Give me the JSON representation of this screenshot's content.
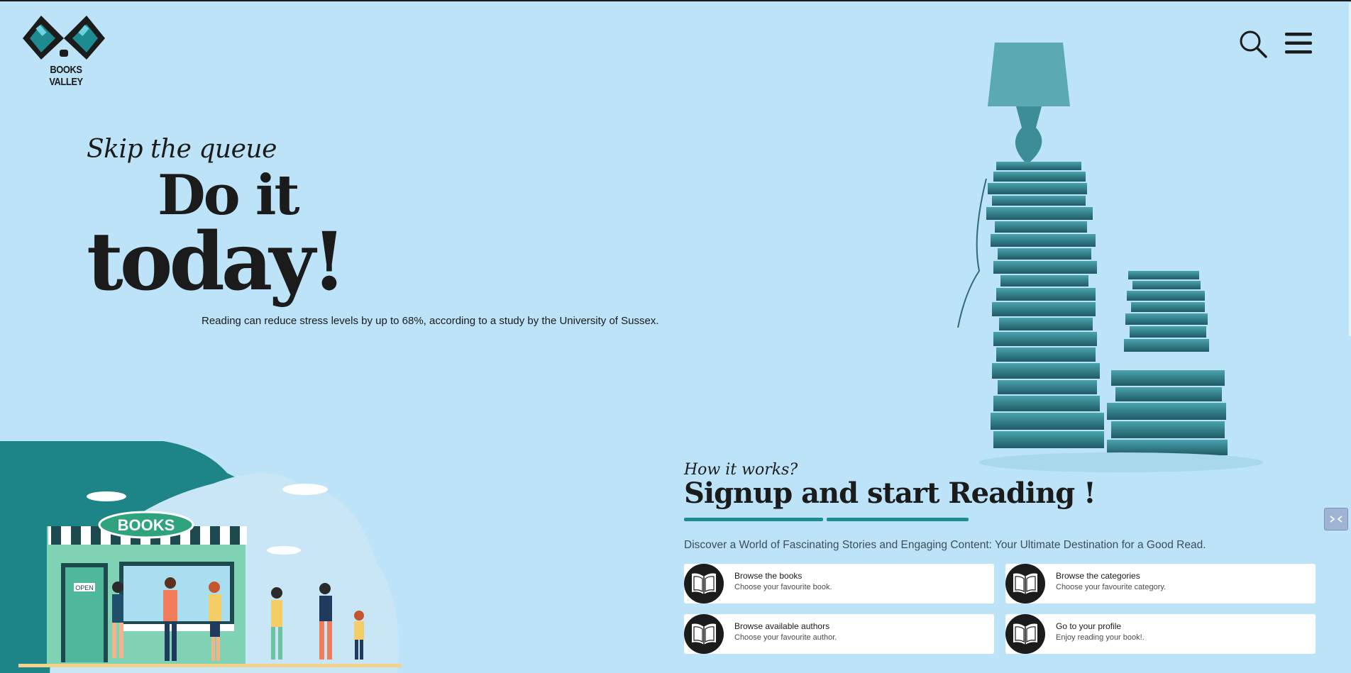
{
  "brand": {
    "name": "BOOKS VALLEY",
    "colors": {
      "primary": "#1b1b1b",
      "accent": "#1d8b8f",
      "background": "#bce3f7"
    }
  },
  "header": {
    "icons": [
      "search-icon",
      "hamburger-menu-icon"
    ]
  },
  "hero": {
    "tagline": "Skip the queue",
    "headline_line1": "Do it",
    "headline_line2": "today!",
    "fact": "Reading can reduce stress levels by up to 68%, according to a study by the University of Sussex."
  },
  "shop_illustration": {
    "sign": "BOOKS",
    "door_sign": "OPEN"
  },
  "how_it_works": {
    "kicker": "How it works?",
    "title": "Signup and start Reading !",
    "description": "Discover a World of Fascinating Stories and Engaging Content: Your Ultimate Destination for a Good Read.",
    "cards": [
      {
        "title": "Browse the books",
        "description": "Choose your favourite book.",
        "icon": "open-book-icon"
      },
      {
        "title": "Browse the categories",
        "description": "Choose your favourite category.",
        "icon": "open-book-icon"
      },
      {
        "title": "Browse available authors",
        "description": "Choose your favourite author.",
        "icon": "open-book-icon"
      },
      {
        "title": "Go to your profile",
        "description": "Enjoy reading your book!.",
        "icon": "open-book-icon"
      }
    ]
  },
  "side_tab": {
    "icon": "extension-icon"
  }
}
